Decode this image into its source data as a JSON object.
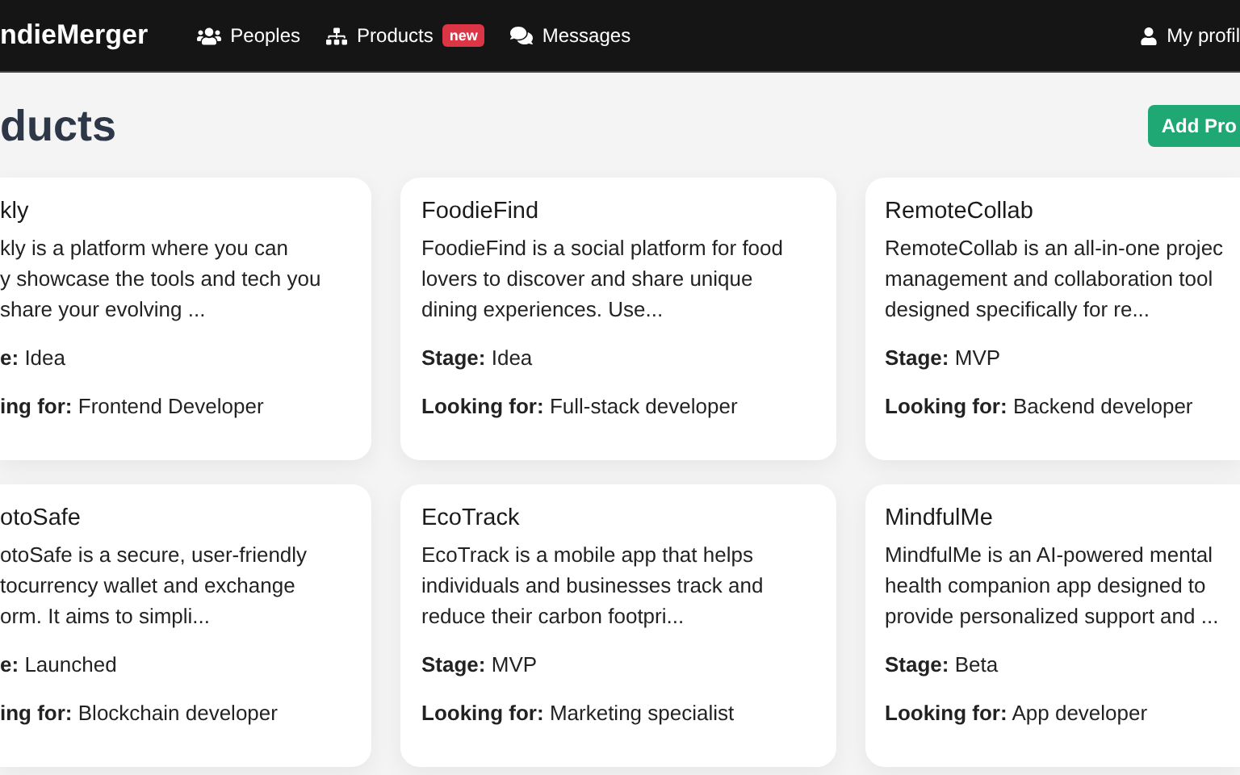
{
  "navbar": {
    "logo": "ndieMerger",
    "items": [
      {
        "kind": "people",
        "label": "Peoples"
      },
      {
        "kind": "products",
        "label": "Products",
        "badge": "new"
      },
      {
        "kind": "messages",
        "label": "Messages"
      }
    ],
    "profile": "My profil"
  },
  "page": {
    "title": "ducts",
    "add_button": "Add Pro"
  },
  "cards": [
    {
      "title": "kly",
      "description": [
        "kly is a platform where you can",
        "y showcase the tools and tech you",
        "share your evolving ..."
      ],
      "stage_label": "e:",
      "stage": "Idea",
      "looking_label": "ing for:",
      "looking_for": "Frontend Developer"
    },
    {
      "title": "FoodieFind",
      "description": [
        "FoodieFind is a social platform for food",
        "lovers to discover and share unique",
        "dining experiences. Use..."
      ],
      "stage_label": "Stage:",
      "stage": "Idea",
      "looking_label": "Looking for:",
      "looking_for": "Full-stack developer"
    },
    {
      "title": "RemoteCollab",
      "description": [
        "RemoteCollab is an all-in-one projec",
        "management and collaboration tool",
        "designed specifically for re..."
      ],
      "stage_label": "Stage:",
      "stage": "MVP",
      "looking_label": "Looking for:",
      "looking_for": "Backend developer"
    },
    {
      "title": "otoSafe",
      "description": [
        "otoSafe is a secure, user-friendly",
        "tocurrency wallet and exchange",
        "orm. It aims to simpli..."
      ],
      "stage_label": "e:",
      "stage": "Launched",
      "looking_label": "ing for:",
      "looking_for": "Blockchain developer"
    },
    {
      "title": "EcoTrack",
      "description": [
        "EcoTrack is a mobile app that helps",
        "individuals and businesses track and",
        "reduce their carbon footpri..."
      ],
      "stage_label": "Stage:",
      "stage": "MVP",
      "looking_label": "Looking for:",
      "looking_for": "Marketing specialist"
    },
    {
      "title": "MindfulMe",
      "description": [
        "MindfulMe is an AI-powered mental",
        "health companion app designed to",
        "provide personalized support and ..."
      ],
      "stage_label": "Stage:",
      "stage": "Beta",
      "looking_label": "Looking for:",
      "looking_for": "App developer"
    }
  ]
}
